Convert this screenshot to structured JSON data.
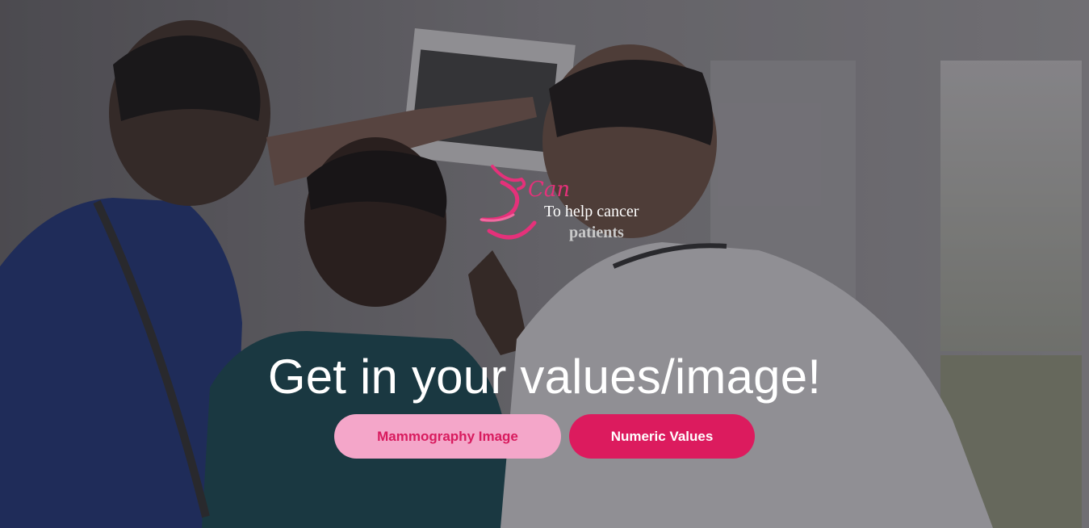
{
  "colors": {
    "accent_pink": "#dc1b5e",
    "light_pink": "#f4a6c9",
    "headline": "#ffffff"
  },
  "logo": {
    "icon": "ribbon-swirl-icon",
    "brand": "Can",
    "tagline_line1": "To help cancer",
    "tagline_line2": "patients"
  },
  "hero": {
    "background": "doctors-reviewing-xray-photo",
    "headline": "Get in your values/image!"
  },
  "actions": {
    "mammography_label": "Mammography Image",
    "numeric_label": "Numeric Values"
  }
}
